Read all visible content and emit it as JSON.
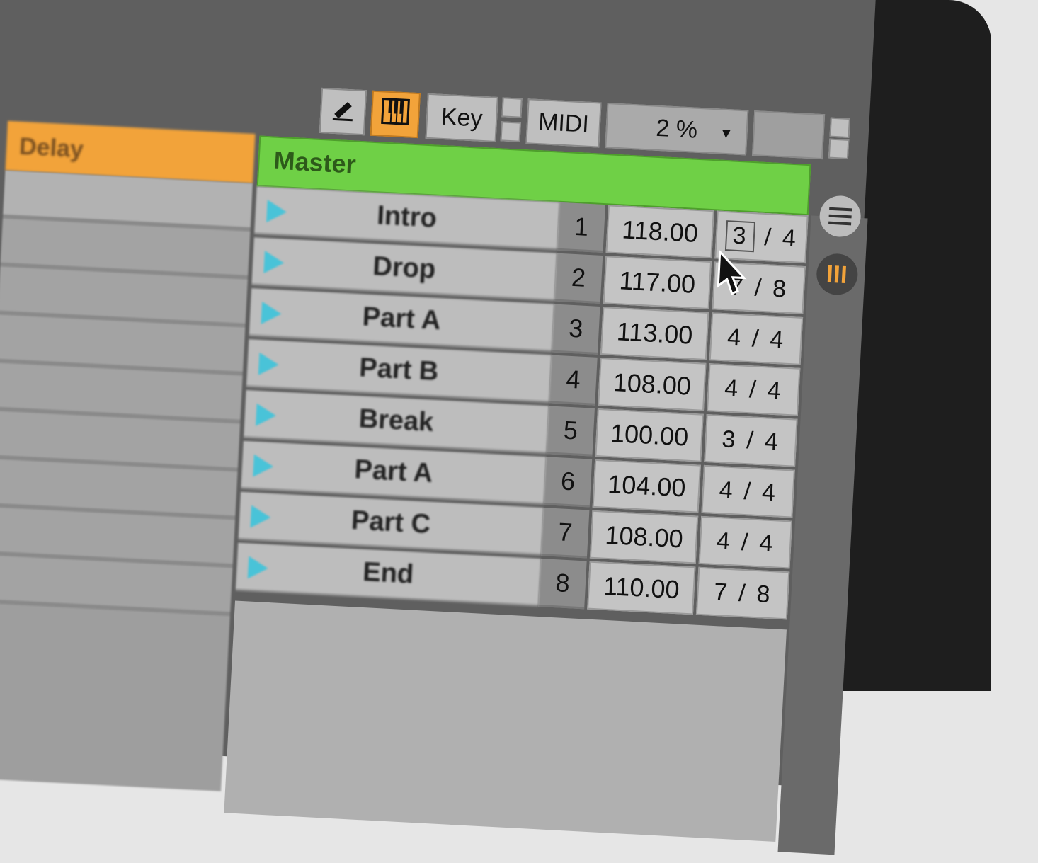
{
  "toolbar": {
    "key_label": "Key",
    "midi_label": "MIDI",
    "quantize_value": "2 %"
  },
  "left_track": {
    "header_label": "Delay"
  },
  "master": {
    "header_label": "Master"
  },
  "scenes": [
    {
      "name": "Intro",
      "number": "1",
      "tempo": "118.00",
      "sig_num": "3",
      "sig_den": "4"
    },
    {
      "name": "Drop",
      "number": "2",
      "tempo": "117.00",
      "sig_num": "7",
      "sig_den": "8"
    },
    {
      "name": "Part A",
      "number": "3",
      "tempo": "113.00",
      "sig_num": "4",
      "sig_den": "4"
    },
    {
      "name": "Part B",
      "number": "4",
      "tempo": "108.00",
      "sig_num": "4",
      "sig_den": "4"
    },
    {
      "name": "Break",
      "number": "5",
      "tempo": "100.00",
      "sig_num": "3",
      "sig_den": "4"
    },
    {
      "name": "Part A",
      "number": "6",
      "tempo": "104.00",
      "sig_num": "4",
      "sig_den": "4"
    },
    {
      "name": "Part C",
      "number": "7",
      "tempo": "108.00",
      "sig_num": "4",
      "sig_den": "4"
    },
    {
      "name": "End",
      "number": "8",
      "tempo": "110.00",
      "sig_num": "7",
      "sig_den": "8"
    }
  ],
  "colors": {
    "master_green": "#6fd046",
    "track_orange": "#f2a33a",
    "play_cyan": "#49c3d8"
  }
}
